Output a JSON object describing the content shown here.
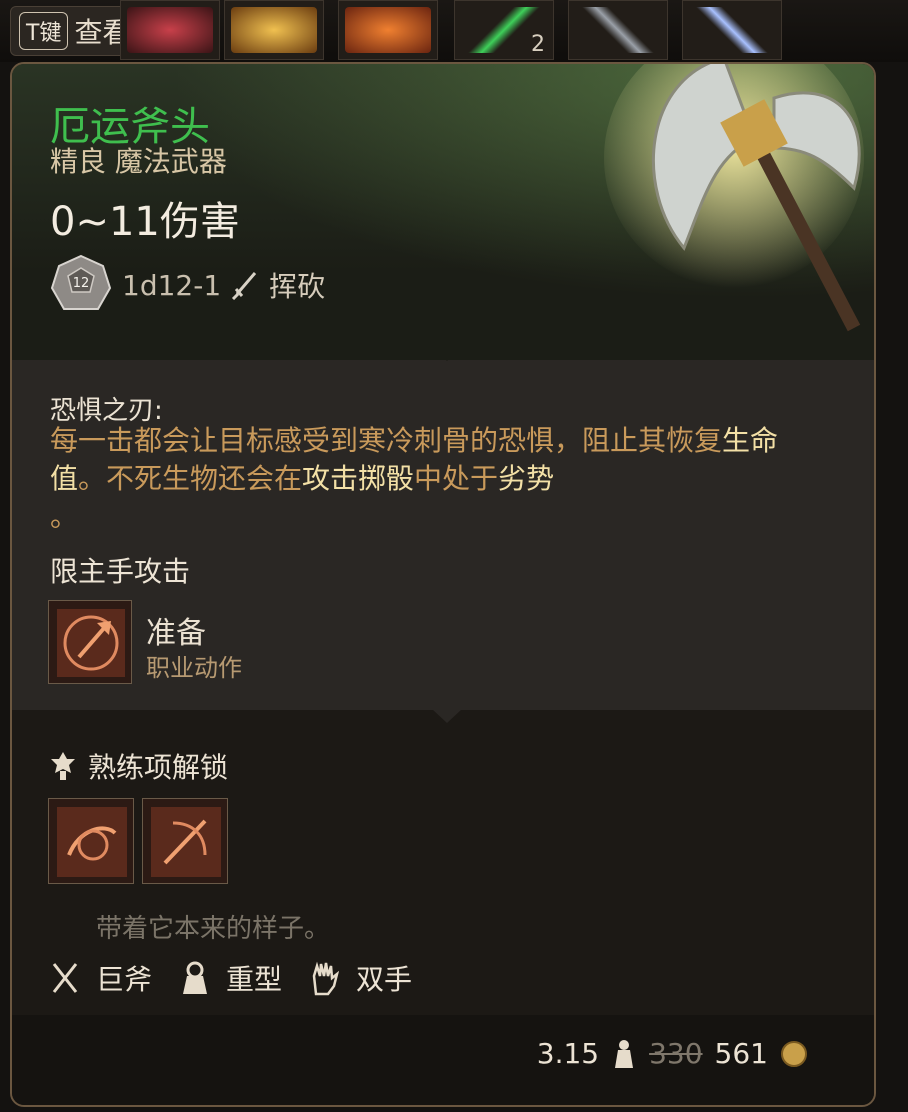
{
  "hotkey": {
    "key": "T键",
    "label": "查看"
  },
  "hotbar": {
    "slot_count": "2"
  },
  "item": {
    "name": "厄运斧头",
    "rarity": "精良 魔法武器",
    "damage": "0~11伤害",
    "dice": "1d12-1",
    "dice_face": "12",
    "damage_type": "挥砍"
  },
  "passive": {
    "title": "恐惧之刃:",
    "desc_1": "每一击都会让目标感受到寒冷刺骨的恐惧，阻止其恢复",
    "hl_1": "生命值",
    "desc_2": "。不死生物还会在",
    "hl_2": "攻击掷骰",
    "desc_3": "中处于",
    "hl_3": "劣势",
    "desc_4": "。"
  },
  "restriction": "限主手攻击",
  "action": {
    "name": "准备",
    "sub": "职业动作"
  },
  "proficiency": {
    "label": "熟练项解锁"
  },
  "flavor": "带着它本来的样子。",
  "tags": {
    "tag1": "巨斧",
    "tag2": "重型",
    "tag3": "双手"
  },
  "footer": {
    "weight": "3.15",
    "old_price": "330",
    "price": "561"
  },
  "colors": {
    "rarity_green": "#3fbf4e",
    "highlight": "#f3e0a6",
    "desc": "#c99a5b"
  },
  "icons": [
    "hotkey-key",
    "dice-d12-icon",
    "sword-icon",
    "prepare-axe-icon",
    "proficiency-icon",
    "unlock-icon",
    "greataxe-icon",
    "heavy-icon",
    "two-handed-icon",
    "weight-icon",
    "coin-icon"
  ]
}
